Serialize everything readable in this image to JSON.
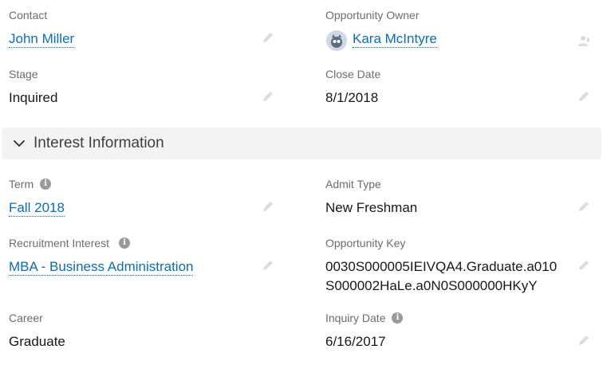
{
  "contact": {
    "label": "Contact",
    "value": "John Miller"
  },
  "owner": {
    "label": "Opportunity Owner",
    "value": "Kara McIntyre"
  },
  "stage": {
    "label": "Stage",
    "value": "Inquired"
  },
  "close_date": {
    "label": "Close Date",
    "value": "8/1/2018"
  },
  "section": {
    "title": "Interest Information"
  },
  "term": {
    "label": "Term",
    "value": "Fall 2018"
  },
  "admit_type": {
    "label": "Admit Type",
    "value": "New Freshman"
  },
  "recruitment_interest": {
    "label": "Recruitment Interest",
    "value": "MBA - Business Administration"
  },
  "opportunity_key": {
    "label": "Opportunity Key",
    "line1": "0030S000005IEIVQA4.Graduate.a010",
    "line2": "S000002HaLe.a0N0S000000HKyY"
  },
  "career": {
    "label": "Career",
    "value": "Graduate"
  },
  "inquiry_date": {
    "label": "Inquiry Date",
    "value": "6/16/2017"
  },
  "info_glyph": "i"
}
